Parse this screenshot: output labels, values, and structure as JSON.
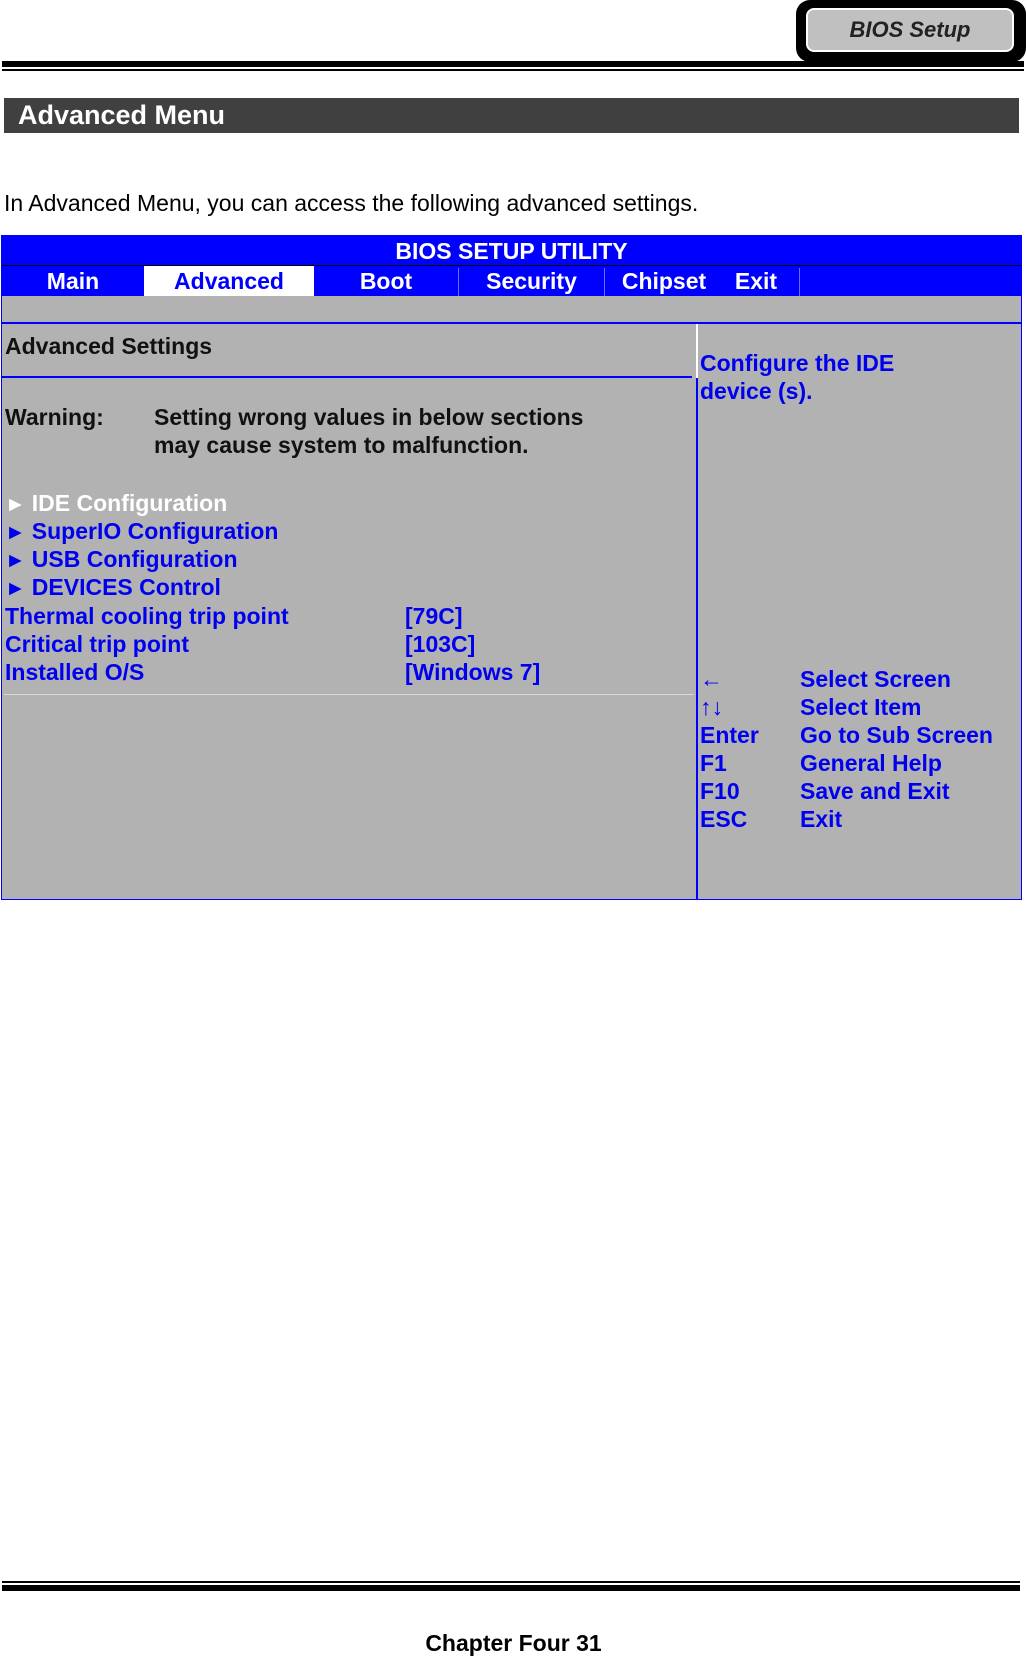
{
  "header": {
    "badge_label": "BIOS Setup"
  },
  "section": {
    "title": "Advanced Menu",
    "intro": "In Advanced Menu, you can access the following advanced settings."
  },
  "bios": {
    "title": "BIOS SETUP UTILITY",
    "tabs": [
      {
        "label": "Main",
        "active": false
      },
      {
        "label": "Advanced",
        "active": true
      },
      {
        "label": "Boot",
        "active": false
      },
      {
        "label": "Security",
        "active": false
      },
      {
        "label": "Chipset",
        "active": false
      },
      {
        "label": "Exit",
        "active": false
      }
    ],
    "panel_heading": "Advanced Settings",
    "warning_label": "Warning:",
    "warning_line1": "Setting wrong values in below sections",
    "warning_line2": "may cause system to malfunction.",
    "submenu_arrow": "►",
    "submenus": [
      {
        "label": "IDE Configuration",
        "selected": true
      },
      {
        "label": "SuperIO Configuration",
        "selected": false
      },
      {
        "label": "USB Configuration",
        "selected": false
      },
      {
        "label": "DEVICES Control",
        "selected": false
      }
    ],
    "settings": [
      {
        "label": "Thermal cooling trip point",
        "value": "[79C]"
      },
      {
        "label": "Critical trip point",
        "value": "[103C]"
      },
      {
        "label": "Installed O/S",
        "value": "[Windows 7]"
      }
    ],
    "help_line1": "Configure the IDE",
    "help_line2": "device (s).",
    "keys": [
      {
        "key": "←",
        "action": "Select Screen"
      },
      {
        "key": "↑↓",
        "action": "Select Item"
      },
      {
        "key": "Enter",
        "action": "Go to Sub Screen"
      },
      {
        "key": "F1",
        "action": "General Help"
      },
      {
        "key": "F10",
        "action": "Save and Exit"
      },
      {
        "key": "ESC",
        "action": "Exit"
      }
    ],
    "colors": {
      "frame_blue": "#0000ff",
      "panel_gray": "#b2b2b2",
      "item_blue": "#0000ee",
      "selected_white": "#ffffff"
    }
  },
  "footer": {
    "page_label": "Chapter Four 31"
  }
}
